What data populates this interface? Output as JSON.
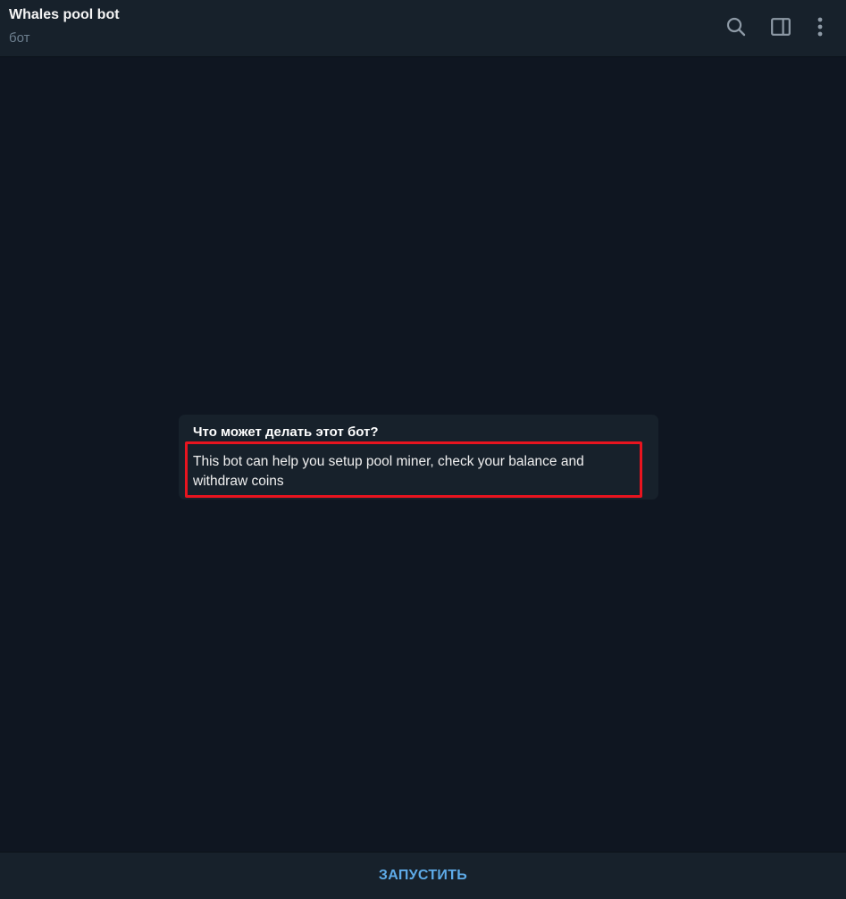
{
  "header": {
    "title": "Whales pool bot",
    "status": "бот",
    "icons": [
      "search-icon",
      "sidebar-panel-icon",
      "more-vertical-icon"
    ]
  },
  "bot_info": {
    "title": "Что может делать этот бот?",
    "description": "This bot can help you setup pool miner, check your balance and withdraw coins"
  },
  "footer": {
    "start_label": "ЗАПУСТИТЬ"
  },
  "colors": {
    "background": "#0f1621",
    "panel": "#17212b",
    "accent": "#5eabe8",
    "highlight": "#e8141f",
    "icon": "#8e9aa6"
  }
}
